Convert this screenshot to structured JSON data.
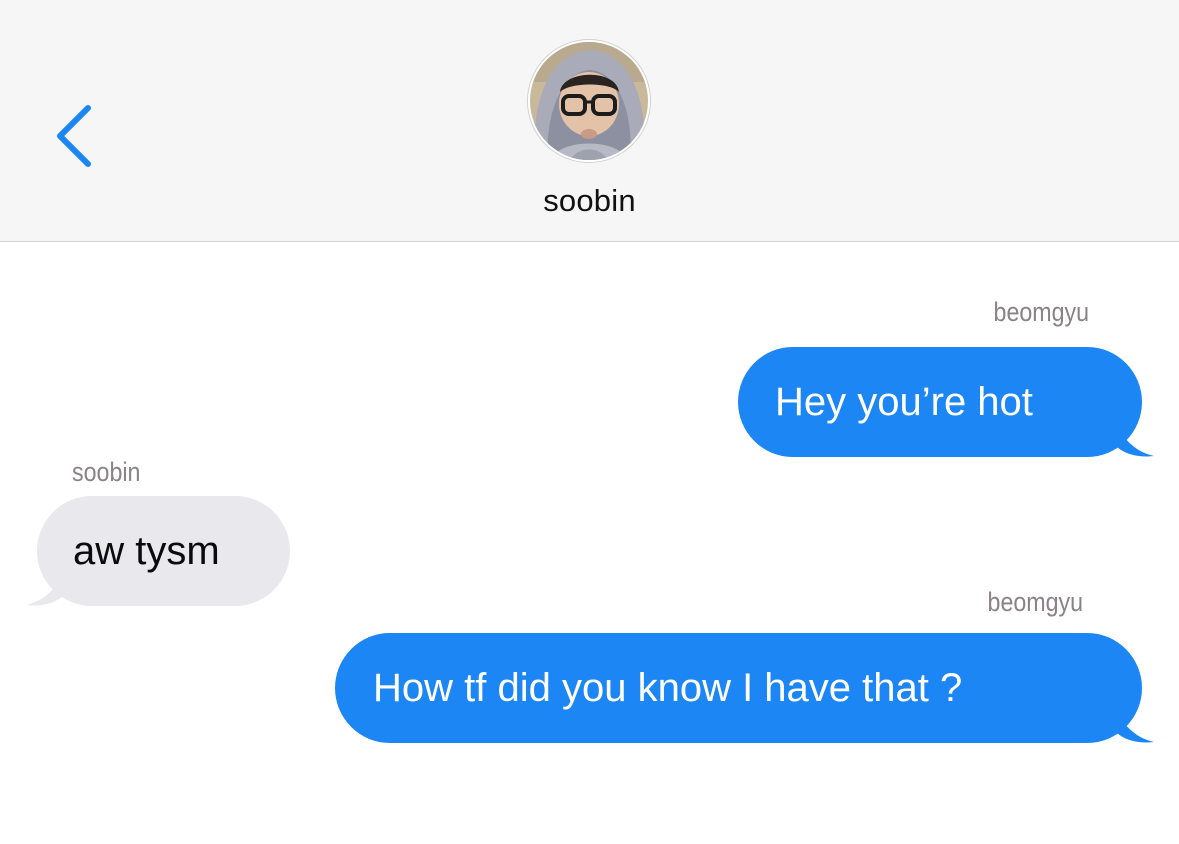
{
  "header": {
    "contact_name": "soobin",
    "back_icon": "chevron-left-icon",
    "accent_color": "#1d86f5"
  },
  "messages": [
    {
      "sender": "beomgyu",
      "direction": "outgoing",
      "text": "Hey you’re hot"
    },
    {
      "sender": "soobin",
      "direction": "incoming",
      "text": "aw tysm"
    },
    {
      "sender": "beomgyu",
      "direction": "outgoing",
      "text": "How tf did you know I have that ?"
    }
  ],
  "colors": {
    "outgoing_bubble": "#1d86f5",
    "incoming_bubble": "#e8e8ed",
    "header_background": "#f6f6f6",
    "sender_label": "#8a8286"
  }
}
